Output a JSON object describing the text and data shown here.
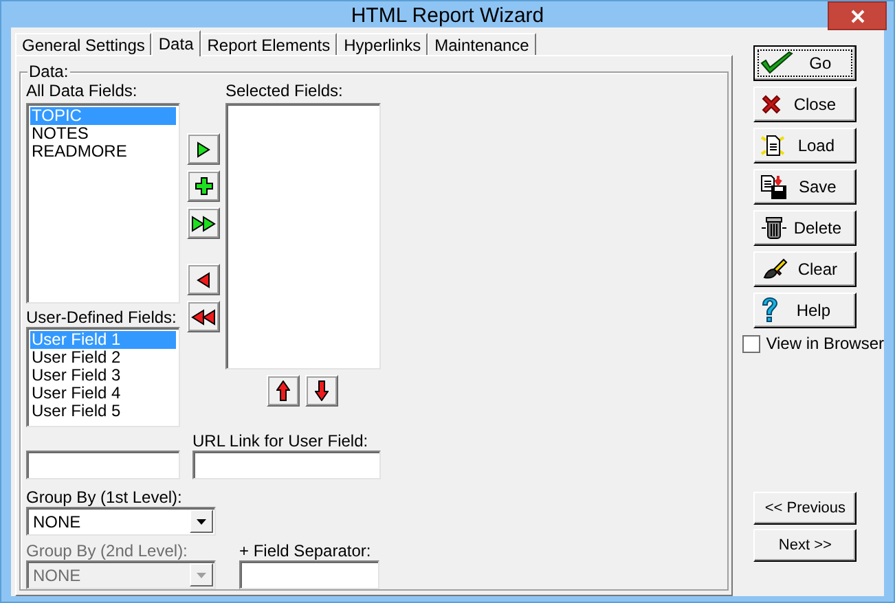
{
  "window": {
    "title": "HTML Report Wizard"
  },
  "tabs": [
    {
      "label": "General Settings",
      "selected": false
    },
    {
      "label": "Data",
      "selected": true
    },
    {
      "label": "Report Elements",
      "selected": false
    },
    {
      "label": "Hyperlinks",
      "selected": false
    },
    {
      "label": "Maintenance",
      "selected": false
    }
  ],
  "data_group": {
    "label": "Data:"
  },
  "all_data_fields": {
    "label": "All Data Fields:",
    "items": [
      {
        "label": "TOPIC",
        "selected": true
      },
      {
        "label": "NOTES",
        "selected": false
      },
      {
        "label": "READMORE",
        "selected": false
      }
    ]
  },
  "move_buttons": [
    {
      "kind": "add"
    },
    {
      "kind": "insert"
    },
    {
      "kind": "add-all"
    },
    {
      "kind": "remove"
    },
    {
      "kind": "remove-all"
    }
  ],
  "selected_fields": {
    "label": "Selected Fields:"
  },
  "order_buttons": [
    {
      "kind": "up"
    },
    {
      "kind": "down"
    }
  ],
  "user_defined_fields": {
    "label": "User-Defined Fields:",
    "items": [
      {
        "label": "User Field 1",
        "selected": true
      },
      {
        "label": "User Field 2",
        "selected": false
      },
      {
        "label": "User Field 3",
        "selected": false
      },
      {
        "label": "User Field 4",
        "selected": false
      },
      {
        "label": "User Field 5",
        "selected": false
      }
    ]
  },
  "url_link": {
    "label": "URL Link for User Field:"
  },
  "group_by_1": {
    "label": "Group By (1st Level):",
    "value": "NONE",
    "disabled": false
  },
  "group_by_2": {
    "label": "Group By (2nd Level):",
    "value": "NONE",
    "disabled": true
  },
  "field_separator": {
    "label": "+ Field Separator:"
  },
  "actions": [
    {
      "label": "Go",
      "kind": "check",
      "default": true
    },
    {
      "label": "Close",
      "kind": "cross",
      "default": false
    },
    {
      "label": "Load",
      "kind": "document",
      "default": false
    },
    {
      "label": "Save",
      "kind": "disk",
      "default": false
    },
    {
      "label": "Delete",
      "kind": "trash",
      "default": false
    },
    {
      "label": "Clear",
      "kind": "brush",
      "default": false
    },
    {
      "label": "Help",
      "kind": "question",
      "default": false
    }
  ],
  "view_in_browser": {
    "label": "View in Browser",
    "checked": false
  },
  "navigation": [
    {
      "label": "<< Previous"
    },
    {
      "label": "Next >>"
    }
  ]
}
